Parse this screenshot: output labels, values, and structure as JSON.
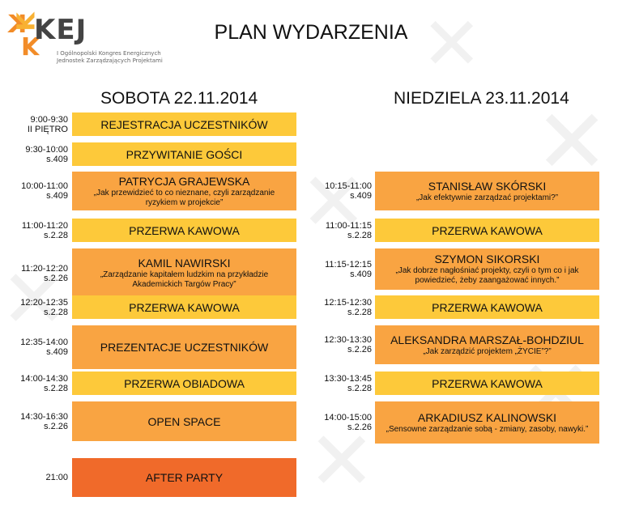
{
  "logo": {
    "text": "KEJ",
    "subtitle_line1": "I Ogólnopolski Kongres Energicznych",
    "subtitle_line2": "Jednostek Zarządzających Projektami"
  },
  "title": "PLAN WYDARZENIA",
  "saturday": {
    "heading": "SOBOTA 22.11.2014",
    "items": [
      {
        "time": "9:00-9:30",
        "room": "II PIĘTRO",
        "main": "REJESTRACJA UCZESTNIKÓW",
        "desc": "",
        "color": "#fdc93a"
      },
      {
        "time": "9:30-10:00",
        "room": "s.409",
        "main": "PRZYWITANIE GOŚCI",
        "desc": "",
        "color": "#fdc93a"
      },
      {
        "time": "10:00-11:00",
        "room": "s.409",
        "main": "PATRYCJA GRAJEWSKA",
        "desc": "„Jak przewidzieć to co nieznane, czyli zarządzanie ryzykiem w projekcie”",
        "color": "#f9a442"
      },
      {
        "time": "11:00-11:20",
        "room": "s.2.28",
        "main": "PRZERWA KAWOWA",
        "desc": "",
        "color": "#fdc93a"
      },
      {
        "time": "11:20-12:20",
        "room": "s.2.26",
        "main": "KAMIL NAWIRSKI",
        "desc": "„Zarządzanie kapitałem ludzkim na przykładzie Akademickich Targów Pracy”",
        "color": "#f9a442"
      },
      {
        "time": "12:20-12:35",
        "room": "s.2.28",
        "main": "PRZERWA KAWOWA",
        "desc": "",
        "color": "#fdc93a"
      },
      {
        "time": "12:35-14:00",
        "room": "s.409",
        "main": "PREZENTACJE UCZESTNIKÓW",
        "desc": "",
        "color": "#f9a442"
      },
      {
        "time": "14:00-14:30",
        "room": "s.2.28",
        "main": "PRZERWA OBIADOWA",
        "desc": "",
        "color": "#fdc93a"
      },
      {
        "time": "14:30-16:30",
        "room": "s.2.26",
        "main": "OPEN SPACE",
        "desc": "",
        "color": "#f9a442"
      },
      {
        "time": "21:00",
        "room": "",
        "main": "AFTER PARTY",
        "desc": "",
        "color": "#f06a2a"
      }
    ]
  },
  "sunday": {
    "heading": "NIEDZIELA 23.11.2014",
    "items": [
      {
        "time": "10:15-11:00",
        "room": "s.409",
        "main": "STANISŁAW SKÓRSKI",
        "desc": "„Jak efektywnie zarządzać projektami?”",
        "color": "#f9a442"
      },
      {
        "time": "11:00-11:15",
        "room": "s.2.28",
        "main": "PRZERWA KAWOWA",
        "desc": "",
        "color": "#fdc93a"
      },
      {
        "time": "11:15-12:15",
        "room": "s.409",
        "main": "SZYMON SIKORSKI",
        "desc": "„Jak dobrze nagłośniać projekty, czyli o tym co i jak powiedzieć, żeby zaangażować innych.”",
        "color": "#f9a442"
      },
      {
        "time": "12:15-12:30",
        "room": "s.2.28",
        "main": "PRZERWA KAWOWA",
        "desc": "",
        "color": "#fdc93a"
      },
      {
        "time": "12:30-13:30",
        "room": "s.2.26",
        "main": "ALEKSANDRA MARSZAŁ-BOHDZIUL",
        "desc": "„Jak zarządzić projektem „ŻYCIE”?”",
        "color": "#f9a442"
      },
      {
        "time": "13:30-13:45",
        "room": "s.2.28",
        "main": "PRZERWA KAWOWA",
        "desc": "",
        "color": "#fdc93a"
      },
      {
        "time": "14:00-15:00",
        "room": "s.2.26",
        "main": "ARKADIUSZ KALINOWSKI",
        "desc": "„Sensowne zarządzanie sobą - zmiany, zasoby, nawyki.”",
        "color": "#f9a442"
      }
    ]
  }
}
